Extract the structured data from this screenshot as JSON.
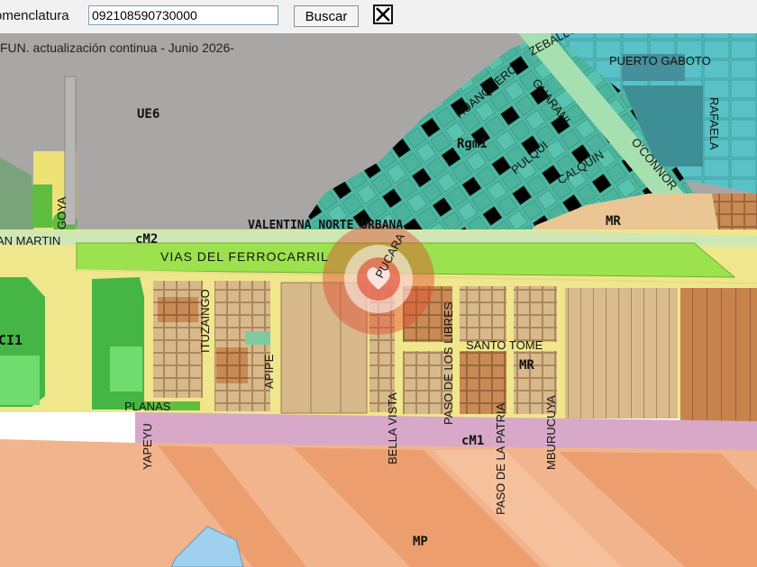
{
  "toolbar": {
    "label": "omenclatura",
    "search_value": "092108590730000",
    "search_button": "Buscar",
    "close_icon": "close-x-icon"
  },
  "map": {
    "notice": "FUN. actualización continua  - Junio 2026-",
    "zones": {
      "ue6": "UE6",
      "rgm1": "Rgm1",
      "mr_top": "MR",
      "mr_mid": "MR",
      "cm2": "cM2",
      "cm1": "cM1",
      "ci1": "CI1",
      "mp": "MP"
    },
    "streets": {
      "zeballos": "ZEBALLOS",
      "puerto_gaboto": "PUERTO GABOTO",
      "rafaela": "RAFAELA",
      "huanquero": "HUANQUERO",
      "guarani": "GUARANI",
      "pulqui": "PULQUI",
      "calquin": "CALQUIN",
      "oconnor": "O'CONNOR",
      "goya": "GOYA",
      "san_martin": "AN MARTIN",
      "valentina": "VALENTINA NORTE URBANA",
      "ferrocarril": "VIAS DEL FERROCARRIL",
      "pucara": "PUCARA",
      "ituzaingo": "ITUZAINGO",
      "apipe": "APIPE",
      "paso_libres": "PASO DE LOS LIBRES",
      "santo_tome": "SANTO TOME",
      "bella_vista": "BELLA VISTA",
      "paso_patria": "PASO DE LA PATRIA",
      "mburucuya": "MBURUCUYA",
      "planas": "PLANAS",
      "yapeyu": "YAPEYU"
    },
    "colors": {
      "gray_zone": "#a9a7a5",
      "teal_zone": "#4fb8a2",
      "cyan_zone": "#58c2c6",
      "yellow_zone": "#f0e68c",
      "green_rail": "#9ce24e",
      "mauve_road": "#d8a8c8",
      "orange_zone": "#f2b48c",
      "tan_block": "#d6b88a",
      "brown_block": "#c9864f",
      "marker": "#e04b2f"
    }
  }
}
